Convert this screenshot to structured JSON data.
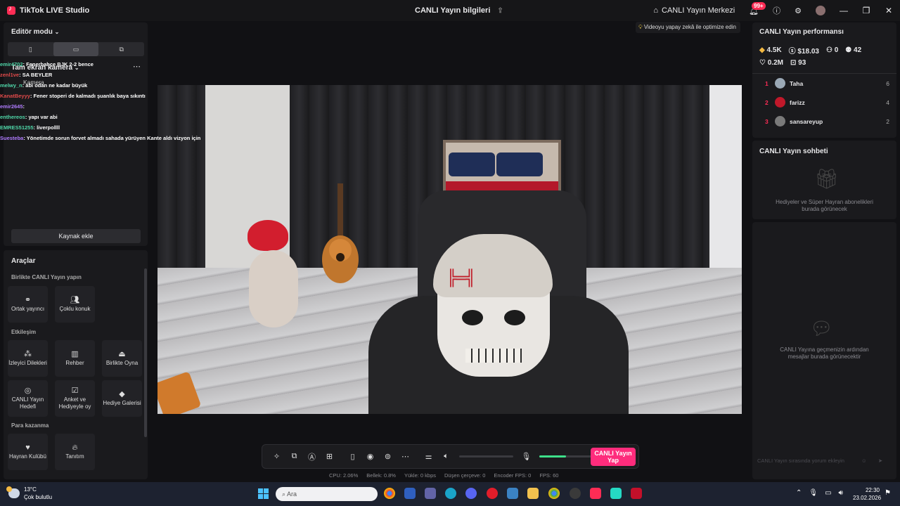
{
  "window": {
    "app_title": "TikTok LIVE Studio",
    "center_title": "CANLI Yayın bilgileri",
    "live_center": "CANLI Yayın Merkezi",
    "notif_badge": "99+"
  },
  "left_panel": {
    "editor_mode": "Editör modu",
    "camera_label": "Tam ekran kamera",
    "camera_source": "Kamera",
    "add_source": "Kaynak ekle",
    "chat": [
      {
        "name": "emir4702",
        "text": ": Fenerbahçe BJK 2-2 bence"
      },
      {
        "name": "zenl1ve",
        "text": ": SA BEYLER"
      },
      {
        "name": "melwy_n",
        "text": ": abi odan ne kadar büyük"
      },
      {
        "name": "KanatBeyyy",
        "text": ": Fener stoperi de kalmadı şuanlık baya sıkıntı"
      },
      {
        "name": "emir2645",
        "text": ":"
      },
      {
        "name": "enthereos",
        "text": ": yapı var abi"
      },
      {
        "name": "EMRES51255",
        "text": ": liverpollll"
      },
      {
        "name": "Suesteba",
        "text": ": Yönetimde sorun forvet almadı sahada yürüyen Kante aldı vizyon için"
      }
    ]
  },
  "tools": {
    "title": "Araçlar",
    "groups": [
      {
        "title": "Birlikte CANLI Yayın yapın",
        "items": [
          "Ortak yayıncı",
          "Çoklu konuk"
        ]
      },
      {
        "title": "Etkileşim",
        "items": [
          "İzleyici Dilekleri",
          "Rehber",
          "Birlikte Oyna",
          "CANLI Yayın Hedefi",
          "Anket ve Hediyeyle oy",
          "Hediye Galerisi"
        ]
      },
      {
        "title": "Para kazanma",
        "items": [
          "Hayran Kulübü",
          "Tanıtım"
        ]
      }
    ]
  },
  "tooltip": "Videoyu yapay zekâ ile optimize edin",
  "bottom_bar": {
    "go_live": "CANLI Yayın Yap",
    "stats": [
      "CPU: 2.06%",
      "Bellek: 0.8%",
      "Yükle: 0 kbps",
      "Düşen çerçeve: 0",
      "Encoder FPS: 0",
      "FPS: 60"
    ]
  },
  "performance": {
    "title": "CANLI Yayın performansı",
    "diamonds": "4.5K",
    "money": "$18.03",
    "viewers": "0",
    "followers": "42",
    "likes": "0.2M",
    "gifts": "93",
    "ranks": [
      {
        "rank": "1",
        "name": "Taha",
        "count": "6"
      },
      {
        "rank": "2",
        "name": "farizz",
        "count": "4"
      },
      {
        "rank": "3",
        "name": "sansareyup",
        "count": "2"
      }
    ]
  },
  "live_chat": {
    "title": "CANLI Yayın sohbeti",
    "gifts_empty": "Hediyeler ve Süper Hayran abonelikleri burada görünecek",
    "messages_empty": "CANLI Yayına geçmenizin ardından mesajlar burada görünecektir",
    "comment_placeholder": "CANLI Yayın sırasında yorum ekleyin"
  },
  "taskbar": {
    "temp": "13°C",
    "weather": "Çok bulutlu",
    "search": "Ara",
    "time": "22:30",
    "date": "23.02.2026"
  }
}
